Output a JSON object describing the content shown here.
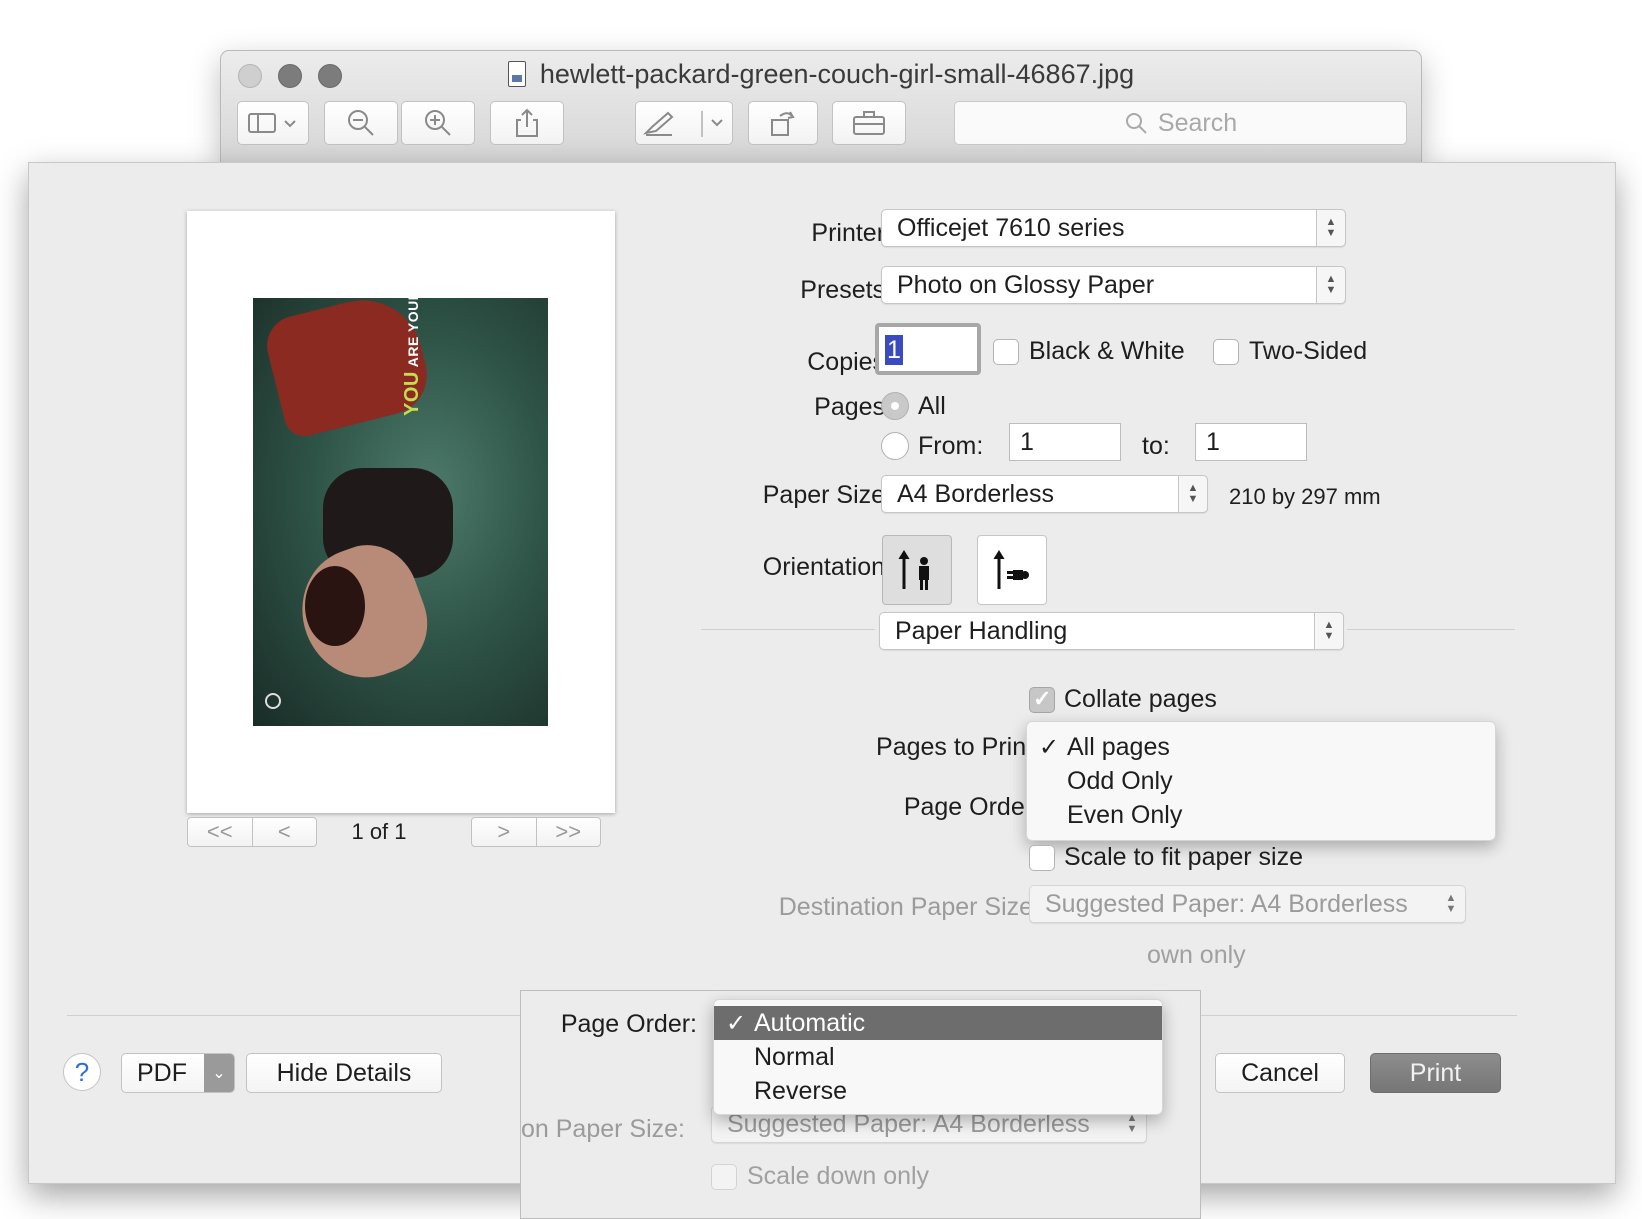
{
  "window": {
    "title": "hewlett-packard-green-couch-girl-small-46867.jpg",
    "search_placeholder": "Search"
  },
  "preview": {
    "page_count": "1 of 1",
    "nav": {
      "first": "<<",
      "prev": "<",
      "next": ">",
      "last": ">>"
    },
    "photo_tagline": "ARE YOUR PLAYLIST.",
    "photo_brand_letters": "YOU"
  },
  "print": {
    "printer_label": "Printer:",
    "printer_value": "Officejet 7610 series",
    "presets_label": "Presets:",
    "presets_value": "Photo on Glossy Paper",
    "copies_label": "Copies:",
    "copies_value": "1",
    "bw_label": "Black & White",
    "two_sided_label": "Two-Sided",
    "pages_label": "Pages:",
    "pages_all_label": "All",
    "pages_from_label": "From:",
    "pages_from_value": "1",
    "pages_to_label": "to:",
    "pages_to_value": "1",
    "paper_size_label": "Paper Size:",
    "paper_size_value": "A4 Borderless",
    "paper_size_dims": "210 by 297 mm",
    "orientation_label": "Orientation:",
    "section_value": "Paper Handling",
    "collate_label": "Collate pages",
    "pages_to_print_label": "Pages to Print:",
    "pages_to_print_options": [
      "All pages",
      "Odd Only",
      "Even Only"
    ],
    "pages_to_print_selected": "All pages",
    "page_order_label": "Page Order:",
    "scale_fit_label": "Scale to fit paper size",
    "dest_paper_label": "Destination Paper Size:",
    "dest_paper_value": "Suggested Paper: A4 Borderless",
    "scale_down_partial": "own only",
    "buttons": {
      "pdf": "PDF",
      "hide_details": "Hide Details",
      "cancel": "Cancel",
      "print": "Print",
      "help": "?"
    }
  },
  "overlay": {
    "page_order_label": "Page Order:",
    "page_order_options": [
      "Automatic",
      "Normal",
      "Reverse"
    ],
    "page_order_selected": "Automatic",
    "dest_paper_partial": "on Paper Size:",
    "dest_paper_value": "Suggested Paper: A4 Borderless",
    "scale_down_label": "Scale down only"
  },
  "colors": {
    "sheet_bg": "#ececec",
    "menu_highlight": "#6d6d6d",
    "selection_blue": "#3b4bbf",
    "help_blue": "#2c6fd6"
  }
}
